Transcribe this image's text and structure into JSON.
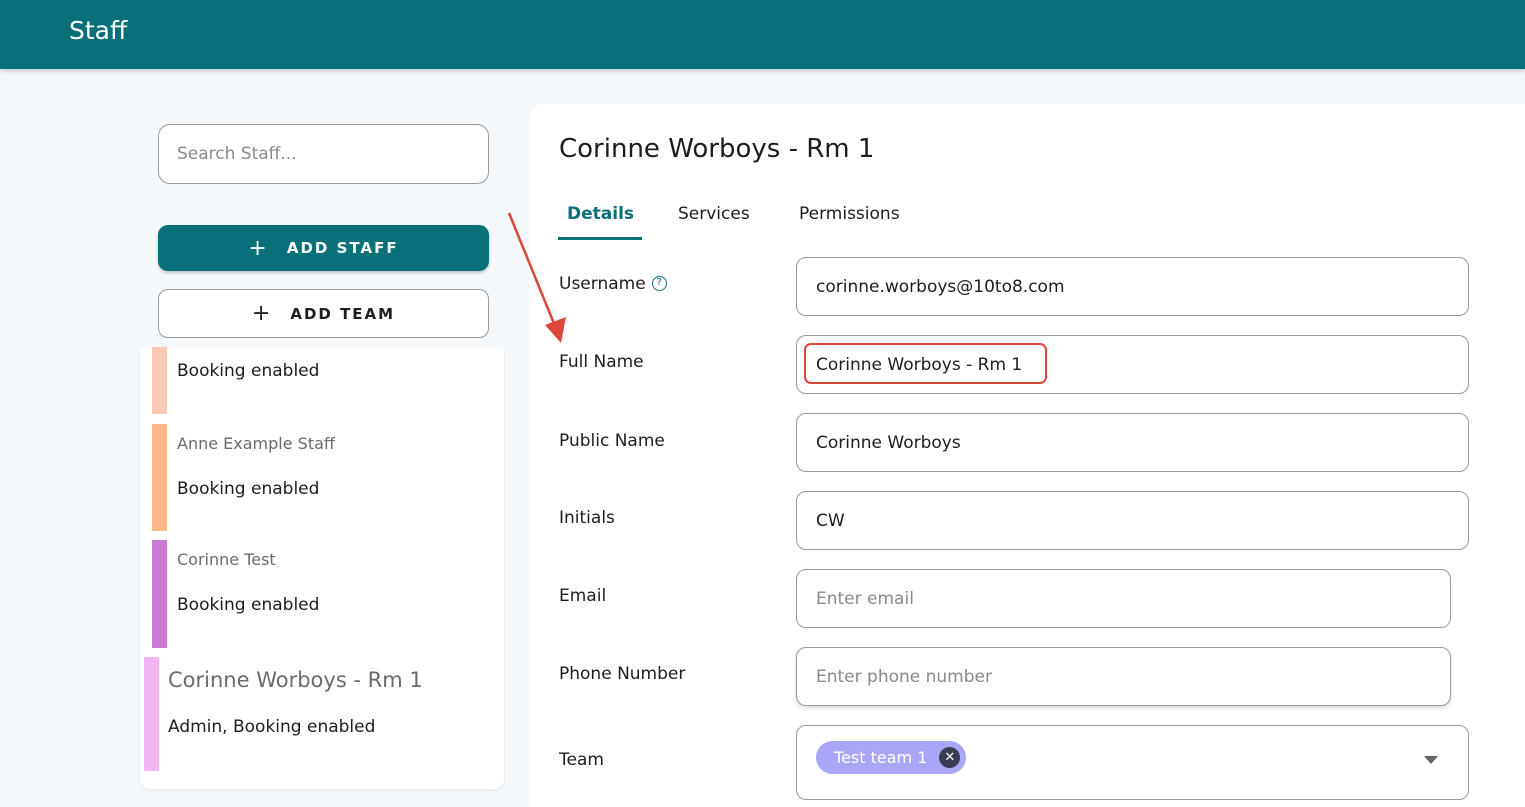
{
  "app": {
    "title": "Staff"
  },
  "sidebar": {
    "search_placeholder": "Search Staff...",
    "add_staff_label": "ADD STAFF",
    "add_team_label": "ADD TEAM",
    "staff": [
      {
        "name": "",
        "status": "Booking enabled",
        "color": "#fdc9b4"
      },
      {
        "name": "Anne Example Staff",
        "status": "Booking enabled",
        "color": "#fcb987"
      },
      {
        "name": "Corinne Test",
        "status": "Booking enabled",
        "color": "#c97ad3"
      },
      {
        "name": "Corinne Worboys - Rm 1",
        "status": "Admin, Booking enabled",
        "color": "#f3b4f3",
        "selected": true
      }
    ]
  },
  "detail": {
    "title": "Corinne Worboys - Rm 1",
    "tabs": [
      "Details",
      "Services",
      "Permissions"
    ],
    "active_tab": "Details",
    "fields": {
      "username": {
        "label": "Username",
        "value": "corinne.worboys@10to8.com"
      },
      "full_name": {
        "label": "Full Name",
        "value": "Corinne Worboys - Rm 1"
      },
      "public_name": {
        "label": "Public Name",
        "value": "Corinne Worboys"
      },
      "initials": {
        "label": "Initials",
        "value": "CW"
      },
      "email": {
        "label": "Email",
        "value": "",
        "placeholder": "Enter email"
      },
      "phone": {
        "label": "Phone Number",
        "value": "",
        "placeholder": "Enter phone number"
      },
      "team": {
        "label": "Team",
        "chips": [
          "Test team 1"
        ]
      }
    }
  },
  "colors": {
    "brand": "#087078",
    "annotation": "#d9483b",
    "chip": "#a9a6f7"
  }
}
